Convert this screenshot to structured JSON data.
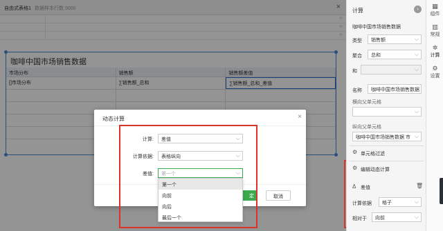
{
  "topbar": {
    "title": "自由式表格1",
    "subtitle": "数据样本行数 5000",
    "close": "×"
  },
  "grid_arrows": "‹ ›",
  "table": {
    "title": "咖啡中国市场销售数据",
    "headers": [
      "市场分布",
      "销售额",
      "销售额差值"
    ],
    "row1": [
      "[]市场分布",
      "∑销售额_总和",
      "∑销售额_总和_差值"
    ]
  },
  "modal": {
    "title": "动态计算",
    "close": "×",
    "fields": [
      {
        "label": "计算:",
        "value": "差值"
      },
      {
        "label": "计算依据:",
        "value": "表格纵向"
      },
      {
        "label": "差值:",
        "value": "第一个"
      }
    ],
    "ok_label": "确定",
    "ok_visible": "定",
    "cancel_label": "取消",
    "dropdown_options": [
      "第一个",
      "向前",
      "向后",
      "最后一个"
    ],
    "dropdown_highlight_index": 0
  },
  "right_panel": {
    "title": "计算",
    "type_label": "类型",
    "type_value": "销售额",
    "agg_label": "聚合",
    "agg_value": "总和",
    "and_label": "和",
    "name_label": "名称",
    "name_value": "咖啡中国市场销售数据",
    "horizontal_parent_label": "横向父单元格",
    "vertical_parent_label": "纵向父单元格",
    "vertical_parent_value": "咖啡中国市场销售数据 市",
    "cell_filter_label": "单元格过滤",
    "edit_dynamic_label": "编辑动态计算",
    "diff_label": "差值",
    "calc_basis_label": "计算依据",
    "calc_basis_value": "格子",
    "relative_label": "相对于",
    "relative_value": "向前"
  },
  "side_tabs": [
    {
      "icon": "grid-icon",
      "label": "组件"
    },
    {
      "icon": "layout-icon",
      "label": "常规"
    },
    {
      "icon": "calc-icon",
      "label": "计算"
    },
    {
      "icon": "gear-icon",
      "label": "设置"
    }
  ],
  "colors": {
    "accent_blue": "#4a88d6",
    "ok_green": "#3ba94e",
    "highlight_red": "#d9342b"
  }
}
